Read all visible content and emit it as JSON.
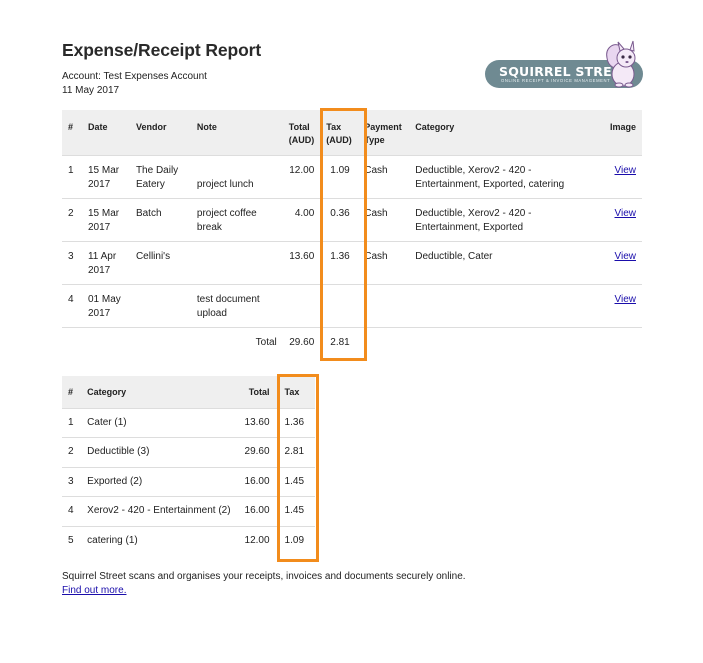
{
  "report": {
    "title": "Expense/Receipt Report",
    "account": "Account: Test Expenses Account",
    "date": "11 May 2017"
  },
  "logo": {
    "title": "SQUIRREL STREET",
    "subtitle": "ONLINE RECEIPT & INVOICE MANAGEMENT",
    "accent_color": "#6f8a92"
  },
  "expenses": {
    "headers": {
      "num": "#",
      "date": "Date",
      "vendor": "Vendor",
      "note": "Note",
      "total": "Total\n(AUD)",
      "tax": "Tax\n(AUD)",
      "payment": "Payment\nType",
      "category": "Category",
      "image": "Image"
    },
    "rows": [
      {
        "num": "1",
        "date": "15 Mar 2017",
        "vendor": "The Daily Eatery",
        "note": "project lunch",
        "total": "12.00",
        "tax": "1.09",
        "payment": "Cash",
        "category": "Deductible, Xerov2 - 420 - Entertainment, Exported, catering",
        "image": "View"
      },
      {
        "num": "2",
        "date": "15 Mar 2017",
        "vendor": "Batch",
        "note": "project coffee break",
        "total": "4.00",
        "tax": "0.36",
        "payment": "Cash",
        "category": "Deductible, Xerov2 - 420 - Entertainment, Exported",
        "image": "View"
      },
      {
        "num": "3",
        "date": "11 Apr 2017",
        "vendor": "Cellini's",
        "note": "",
        "total": "13.60",
        "tax": "1.36",
        "payment": "Cash",
        "category": "Deductible, Cater",
        "image": "View"
      },
      {
        "num": "4",
        "date": "01 May 2017",
        "vendor": "",
        "note": "test document upload",
        "total": "",
        "tax": "",
        "payment": "",
        "category": "",
        "image": "View"
      }
    ],
    "total_label": "Total",
    "total_amount": "29.60",
    "total_tax": "2.81"
  },
  "categories": {
    "headers": {
      "num": "#",
      "category": "Category",
      "total": "Total",
      "tax": "Tax"
    },
    "rows": [
      {
        "num": "1",
        "category": "Cater (1)",
        "total": "13.60",
        "tax": "1.36"
      },
      {
        "num": "2",
        "category": "Deductible (3)",
        "total": "29.60",
        "tax": "2.81"
      },
      {
        "num": "3",
        "category": "Exported (2)",
        "total": "16.00",
        "tax": "1.45"
      },
      {
        "num": "4",
        "category": "Xerov2 - 420 - Entertainment (2)",
        "total": "16.00",
        "tax": "1.45"
      },
      {
        "num": "5",
        "category": "catering (1)",
        "total": "12.00",
        "tax": "1.09"
      }
    ]
  },
  "footer": {
    "text": "Squirrel Street scans and organises your receipts, invoices and documents securely online.",
    "link": "Find out more."
  },
  "highlight_color": "#f28c1c"
}
